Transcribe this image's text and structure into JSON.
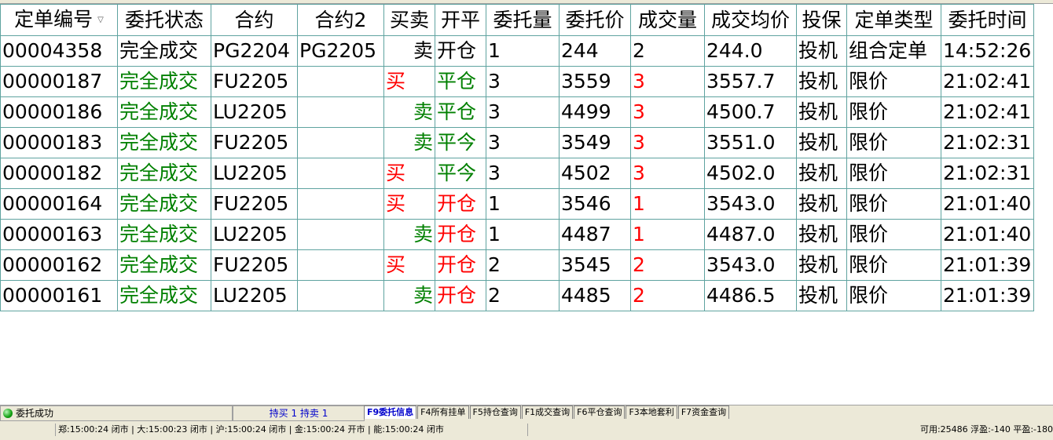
{
  "colors": {
    "green": "#008000",
    "red": "#ff0000",
    "black": "#000000",
    "blue": "#0000cc",
    "grid": "#5fa3a0"
  },
  "table": {
    "headers": [
      "定单编号",
      "委托状态",
      "合约",
      "合约2",
      "买卖",
      "开平",
      "委托量",
      "委托价",
      "成交量",
      "成交均价",
      "投保",
      "定单类型",
      "委托时间"
    ],
    "sort_icon": "sort-desc-icon",
    "rows": [
      {
        "id": "00004358",
        "status": "完全成交",
        "contract": "PG2204",
        "contract2": "PG2205",
        "side": "卖",
        "oc": "开仓",
        "qty": "1",
        "price": "244",
        "filled": "2",
        "avg": "244.0",
        "hedge": "投机",
        "otype": "组合定单",
        "time": "14:52:26",
        "status_color": "#000000",
        "side_color": "#000000",
        "oc_color": "#000000",
        "filled_color": "#000000",
        "side_align": "right"
      },
      {
        "id": "00000187",
        "status": "完全成交",
        "contract": "FU2205",
        "contract2": "",
        "side": "买",
        "oc": "平仓",
        "qty": "3",
        "price": "3559",
        "filled": "3",
        "avg": "3557.7",
        "hedge": "投机",
        "otype": "限价",
        "time": "21:02:41",
        "status_color": "#008000",
        "side_color": "#ff0000",
        "oc_color": "#008000",
        "filled_color": "#ff0000",
        "side_align": "left"
      },
      {
        "id": "00000186",
        "status": "完全成交",
        "contract": "LU2205",
        "contract2": "",
        "side": "卖",
        "oc": "平仓",
        "qty": "3",
        "price": "4499",
        "filled": "3",
        "avg": "4500.7",
        "hedge": "投机",
        "otype": "限价",
        "time": "21:02:41",
        "status_color": "#008000",
        "side_color": "#008000",
        "oc_color": "#008000",
        "filled_color": "#ff0000",
        "side_align": "right"
      },
      {
        "id": "00000183",
        "status": "完全成交",
        "contract": "FU2205",
        "contract2": "",
        "side": "卖",
        "oc": "平今",
        "qty": "3",
        "price": "3549",
        "filled": "3",
        "avg": "3551.0",
        "hedge": "投机",
        "otype": "限价",
        "time": "21:02:31",
        "status_color": "#008000",
        "side_color": "#008000",
        "oc_color": "#008000",
        "filled_color": "#ff0000",
        "side_align": "right"
      },
      {
        "id": "00000182",
        "status": "完全成交",
        "contract": "LU2205",
        "contract2": "",
        "side": "买",
        "oc": "平今",
        "qty": "3",
        "price": "4502",
        "filled": "3",
        "avg": "4502.0",
        "hedge": "投机",
        "otype": "限价",
        "time": "21:02:31",
        "status_color": "#008000",
        "side_color": "#ff0000",
        "oc_color": "#008000",
        "filled_color": "#ff0000",
        "side_align": "left"
      },
      {
        "id": "00000164",
        "status": "完全成交",
        "contract": "FU2205",
        "contract2": "",
        "side": "买",
        "oc": "开仓",
        "qty": "1",
        "price": "3546",
        "filled": "1",
        "avg": "3543.0",
        "hedge": "投机",
        "otype": "限价",
        "time": "21:01:40",
        "status_color": "#008000",
        "side_color": "#ff0000",
        "oc_color": "#ff0000",
        "filled_color": "#ff0000",
        "side_align": "left"
      },
      {
        "id": "00000163",
        "status": "完全成交",
        "contract": "LU2205",
        "contract2": "",
        "side": "卖",
        "oc": "开仓",
        "qty": "1",
        "price": "4487",
        "filled": "1",
        "avg": "4487.0",
        "hedge": "投机",
        "otype": "限价",
        "time": "21:01:40",
        "status_color": "#008000",
        "side_color": "#008000",
        "oc_color": "#ff0000",
        "filled_color": "#ff0000",
        "side_align": "right"
      },
      {
        "id": "00000162",
        "status": "完全成交",
        "contract": "FU2205",
        "contract2": "",
        "side": "买",
        "oc": "开仓",
        "qty": "2",
        "price": "3545",
        "filled": "2",
        "avg": "3543.0",
        "hedge": "投机",
        "otype": "限价",
        "time": "21:01:39",
        "status_color": "#008000",
        "side_color": "#ff0000",
        "oc_color": "#ff0000",
        "filled_color": "#ff0000",
        "side_align": "left"
      },
      {
        "id": "00000161",
        "status": "完全成交",
        "contract": "LU2205",
        "contract2": "",
        "side": "卖",
        "oc": "开仓",
        "qty": "2",
        "price": "4485",
        "filled": "2",
        "avg": "4486.5",
        "hedge": "投机",
        "otype": "限价",
        "time": "21:01:39",
        "status_color": "#008000",
        "side_color": "#008000",
        "oc_color": "#ff0000",
        "filled_color": "#ff0000",
        "side_align": "right"
      }
    ]
  },
  "status": {
    "icon": "green-status-led-icon",
    "message": "委托成功"
  },
  "holdings": "持买 1  持卖 1",
  "tabs": [
    {
      "label": "F9委托信息",
      "active": true
    },
    {
      "label": "F4所有挂单",
      "active": false
    },
    {
      "label": "F5持仓查询",
      "active": false
    },
    {
      "label": "F1成交查询",
      "active": false
    },
    {
      "label": "F6平仓查询",
      "active": false
    },
    {
      "label": "F3本地套利",
      "active": false
    },
    {
      "label": "F7资金查询",
      "active": false
    }
  ],
  "exchange_status": "郑:15:00:24 闭市 | 大:15:00:23 闭市 | 沪:15:00:24 闭市 | 金:15:00:24 开市 | 能:15:00:24 闭市",
  "account_summary": "可用:25486 浮盈:-140 平盈:-180"
}
